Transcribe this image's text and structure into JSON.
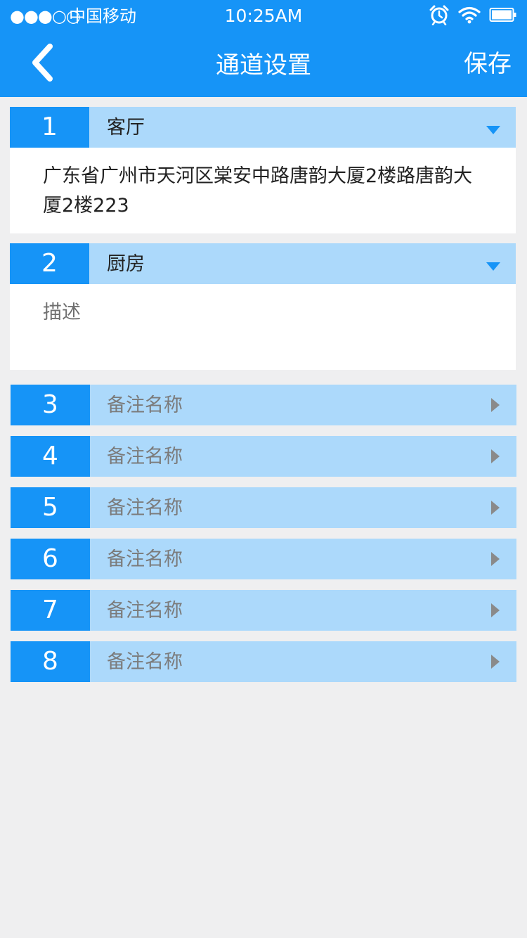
{
  "status_bar": {
    "signal": "●●●○○",
    "carrier": "中国移动",
    "time": "10:25AM",
    "icons": [
      "alarm-icon",
      "wifi-icon",
      "battery-icon"
    ]
  },
  "nav": {
    "back_icon": "chevron-left-icon",
    "title": "通道设置",
    "save_label": "保存"
  },
  "channels_expanded": [
    {
      "number": "1",
      "name": "客厅",
      "description": "广东省广州市天河区棠安中路唐韵大厦2楼路唐韵大厦2楼223",
      "description_is_placeholder": false
    },
    {
      "number": "2",
      "name": "厨房",
      "description": "描述",
      "description_is_placeholder": true
    }
  ],
  "channels_collapsed": [
    {
      "number": "3",
      "name_placeholder": "备注名称"
    },
    {
      "number": "4",
      "name_placeholder": "备注名称"
    },
    {
      "number": "5",
      "name_placeholder": "备注名称"
    },
    {
      "number": "6",
      "name_placeholder": "备注名称"
    },
    {
      "number": "7",
      "name_placeholder": "备注名称"
    },
    {
      "number": "8",
      "name_placeholder": "备注名称"
    }
  ],
  "colors": {
    "primary": "#1694f7",
    "row_background": "#acd9fb",
    "page_background": "#efeff0",
    "placeholder_text": "#7b7b7b"
  }
}
